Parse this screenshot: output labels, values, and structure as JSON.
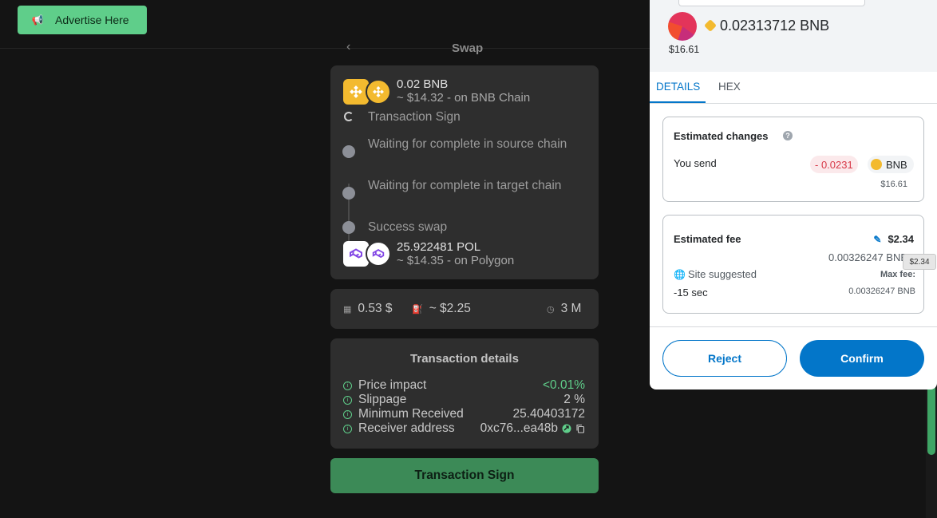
{
  "topbar": {
    "advertise_label": "Advertise Here"
  },
  "swap": {
    "title": "Swap"
  },
  "route": {
    "from": {
      "amount": "0.02 BNB",
      "sub": "~ $14.32 - on BNB Chain"
    },
    "steps": [
      "Transaction Sign",
      "Waiting for complete in source chain",
      "Waiting for complete in target chain",
      "Success swap"
    ],
    "to": {
      "amount": "25.922481 POL",
      "sub": "~ $14.35 - on Polygon"
    }
  },
  "stats": {
    "fee": "0.53 $",
    "gas": "~ $2.25",
    "time": "3 M"
  },
  "details": {
    "title": "Transaction details",
    "rows": [
      {
        "label": "Price impact",
        "value": "<0.01%"
      },
      {
        "label": "Slippage",
        "value": "2 %"
      },
      {
        "label": "Minimum Received",
        "value": "25.40403172"
      },
      {
        "label": "Receiver address",
        "value": "0xc76...ea48b"
      }
    ]
  },
  "sign_button": "Transaction Sign",
  "wallet": {
    "amount": "0.02313712 BNB",
    "usd": "$16.61",
    "tabs": [
      "DETAILS",
      "HEX"
    ],
    "changes": {
      "title": "Estimated changes",
      "you_send": "You send",
      "delta": "- 0.0231",
      "token": "BNB",
      "usd": "$16.61"
    },
    "fee": {
      "title": "Estimated fee",
      "value": "$2.34",
      "native": "0.00326247 BNB",
      "site_suggested": "Site suggested",
      "time": "-15 sec",
      "max_fee_label": "Max fee:",
      "max_fee_value": "0.00326247 BNB"
    },
    "reject": "Reject",
    "confirm": "Confirm"
  },
  "tooltip": "$2.34",
  "colors": {
    "accent_green": "#5fce8a",
    "brand_blue": "#0376c9",
    "bnb_yellow": "#f3ba2f"
  }
}
